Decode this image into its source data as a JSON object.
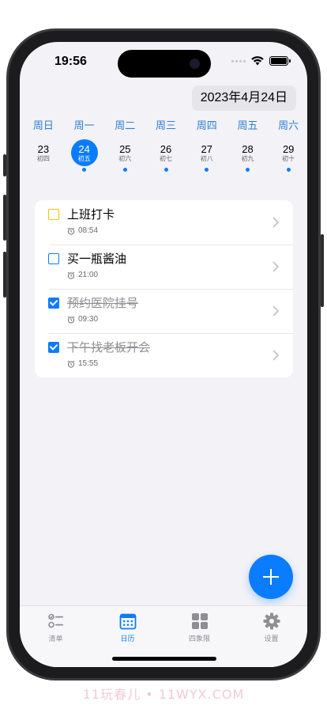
{
  "status_bar": {
    "time": "19:56"
  },
  "header": {
    "date": "2023年4月24日"
  },
  "week": [
    {
      "weekday": "周日",
      "day": "23",
      "lunar": "初四",
      "selected": false,
      "has_event": false
    },
    {
      "weekday": "周一",
      "day": "24",
      "lunar": "初五",
      "selected": true,
      "has_event": true
    },
    {
      "weekday": "周二",
      "day": "25",
      "lunar": "初六",
      "selected": false,
      "has_event": true
    },
    {
      "weekday": "周三",
      "day": "26",
      "lunar": "初七",
      "selected": false,
      "has_event": true
    },
    {
      "weekday": "周四",
      "day": "27",
      "lunar": "初八",
      "selected": false,
      "has_event": true
    },
    {
      "weekday": "周五",
      "day": "28",
      "lunar": "初九",
      "selected": false,
      "has_event": true
    },
    {
      "weekday": "周六",
      "day": "29",
      "lunar": "初十",
      "selected": false,
      "has_event": true
    }
  ],
  "todos": [
    {
      "title": "上班打卡",
      "time": "08:54",
      "done": false,
      "checkbox_color": "#f4c20d"
    },
    {
      "title": "买一瓶酱油",
      "time": "21:00",
      "done": false,
      "checkbox_color": "#0a7cff"
    },
    {
      "title": "预约医院挂号",
      "time": "09:30",
      "done": true,
      "checkbox_color": "#0a7cff"
    },
    {
      "title": "下午找老板开会",
      "time": "15:55",
      "done": true,
      "checkbox_color": "#0a7cff"
    }
  ],
  "tabs": [
    {
      "label": "清单",
      "icon": "list-icon",
      "active": false
    },
    {
      "label": "日历",
      "icon": "calendar-icon",
      "active": true
    },
    {
      "label": "四象限",
      "icon": "grid-icon",
      "active": false
    },
    {
      "label": "设置",
      "icon": "gear-icon",
      "active": false
    }
  ],
  "watermark": "11玩春儿 • 11WYX.COM",
  "colors": {
    "accent": "#0a7cff",
    "weekday": "#2f7fd6",
    "pending_highlight": "#f4c20d"
  }
}
